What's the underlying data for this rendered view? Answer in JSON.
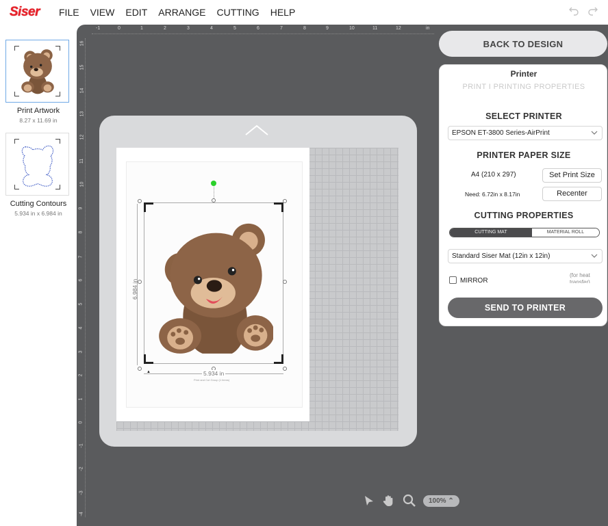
{
  "app": {
    "logo_text": "Siser"
  },
  "menu": [
    "FILE",
    "VIEW",
    "EDIT",
    "ARRANGE",
    "CUTTING",
    "HELP"
  ],
  "left_panel": {
    "items": [
      {
        "label": "Print Artwork",
        "size": "8.27 x 11.69 in"
      },
      {
        "label": "Cutting Contours",
        "size": "5.934 in x 6.984 in"
      }
    ]
  },
  "ruler": {
    "top": [
      "-1",
      "0",
      "1",
      "2",
      "3",
      "4",
      "5",
      "6",
      "7",
      "8",
      "9",
      "10",
      "11",
      "12",
      "in"
    ],
    "left": [
      "16",
      "15",
      "14",
      "13",
      "12",
      "11",
      "10",
      "9",
      "8",
      "7",
      "6",
      "5",
      "4",
      "3",
      "2",
      "1",
      "0",
      "-1",
      "-2",
      "-3",
      "-4"
    ]
  },
  "canvas": {
    "height_label": "6.984 in",
    "width_label": "5.934 in",
    "width_sub": "Print and Cut Group (1 items)"
  },
  "bottom_toolbar": {
    "zoom": "100%"
  },
  "right_panel": {
    "back_button": "BACK TO DESIGN",
    "title": "Printer",
    "tabs": "PRINT  I  PRINTING PROPERTIES",
    "select_printer_heading": "SELECT PRINTER",
    "printer_value": "EPSON ET-3800 Series-AirPrint",
    "paper_size_heading": "PRINTER PAPER SIZE",
    "paper_size": "A4 (210 x 297)",
    "set_print_size_button": "Set Print Size",
    "need_text": "Need: 6.72in x 8.17in",
    "recenter_button": "Recenter",
    "cutting_properties_heading": "CUTTING PROPERTIES",
    "toggle_on": "CUTTING MAT",
    "toggle_off": "MATERIAL ROLL",
    "mat_value": "Standard Siser Mat (12in x 12in)",
    "mirror_label": "MIRROR",
    "mirror_note": "(for heat transfer)",
    "send_button": "SEND TO PRINTER"
  },
  "colors": {
    "logo": "#e8202a",
    "workspace": "#5a5b5d",
    "accent_green": "#2bd12b"
  }
}
